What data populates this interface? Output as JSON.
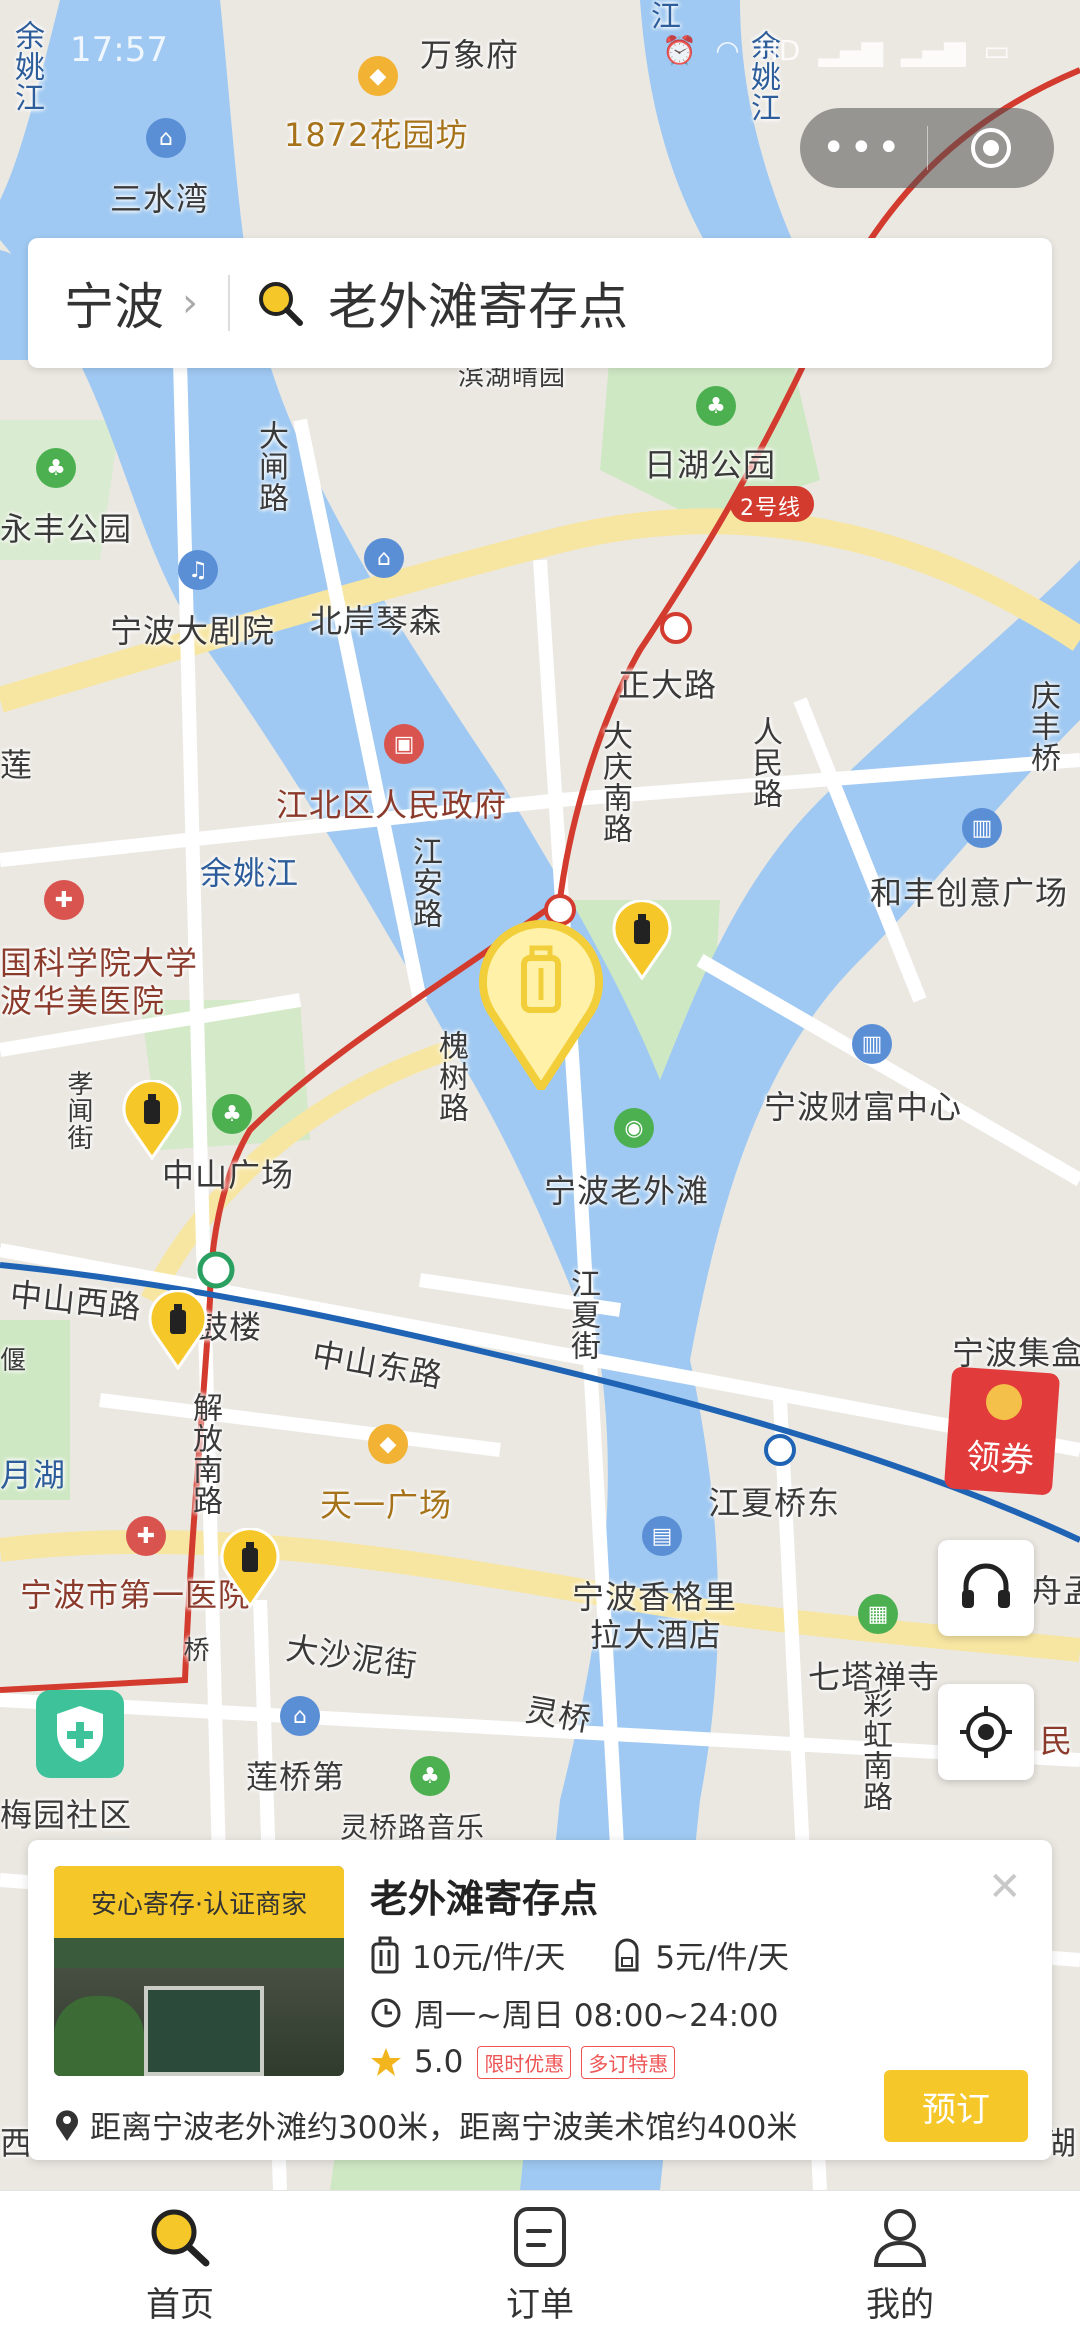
{
  "status_bar": {
    "time": "17:57",
    "network": "HD"
  },
  "capsule": {
    "more_icon": "more-dots-icon",
    "close_icon": "target-close-icon"
  },
  "search": {
    "city": "宁波",
    "query": "老外滩寄存点"
  },
  "map": {
    "labels": {
      "wanxiangfu": "万象府",
      "garden": "1872花园坊",
      "sanshuiwan": "三水湾",
      "binhu": "滨湖晴园",
      "rihu_park": "日湖公园",
      "line2": "2号线",
      "yongfeng_park": "永丰公园",
      "dajuyuan": "宁波大剧院",
      "beian": "北岸琴森",
      "dazha_road": "大闸路",
      "zhengda_road": "正大路",
      "jiangbei_gov": "江北区人民政府",
      "yuyao_river": "余姚江",
      "daqing_south": "大庆南路",
      "renmin_road": "人民路",
      "hefeng": "和丰创意广场",
      "jiangan_road": "江安路",
      "hospital_a": "国科学院大学",
      "hospital_b": "波华美医院",
      "zhongshan_square": "中山广场",
      "huaishu_road": "槐树路",
      "wealth_center": "宁波财富中心",
      "laowaitan": "宁波老外滩",
      "zhongshan_west": "中山西路",
      "gulou": "鼓楼",
      "zhongshan_east": "中山东路",
      "jiangxia_street": "江夏街",
      "jiefang_south": "解放南路",
      "tianyi_square": "天一广场",
      "jiangxia_bridge_east": "江夏桥东",
      "first_hospital": "宁波市第一医院",
      "shangri_la_a": "宁波香格里",
      "shangri_la_b": "拉大酒店",
      "dashanini": "大沙泥街",
      "qitachan": "七塔禅寺",
      "lingqiao": "灵桥",
      "caihong_south": "彩虹南路",
      "lianqiao": "莲桥第",
      "lingqiao_music": "灵桥路音乐",
      "meiyuan": "梅园社区",
      "jihui": "宁波集盒",
      "yuehu": "月湖",
      "qingfeng": "庆丰桥",
      "xiaojie": "孝闻街",
      "fuhai": "舟孟",
      "minle": "民",
      "yuyao_top": "余姚江",
      "jiang": "江",
      "yuyao_left": "余姚江",
      "qiao": "桥",
      "yan": "偃",
      "xi": "西",
      "hu": "湖",
      "lian": "莲"
    }
  },
  "coupon": {
    "label": "领券"
  },
  "store": {
    "tag": "安心寄存·认证商家",
    "name": "老外滩寄存点",
    "price_luggage": "10元/件/天",
    "price_bag": "5元/件/天",
    "hours": "周一~周日 08:00~24:00",
    "rating": "5.0",
    "badge_limited": "限时优惠",
    "badge_multi": "多订特惠",
    "address": "距离宁波老外滩约300米，距离宁波美术馆约400米",
    "book_label": "预订"
  },
  "tabs": [
    {
      "label": "首页",
      "icon": "search-icon"
    },
    {
      "label": "订单",
      "icon": "order-icon"
    },
    {
      "label": "我的",
      "icon": "user-icon"
    }
  ],
  "colors": {
    "accent": "#f6c728",
    "river": "#8bbcef",
    "metro_red": "#d33b2f",
    "metro_blue": "#1f63b4"
  }
}
